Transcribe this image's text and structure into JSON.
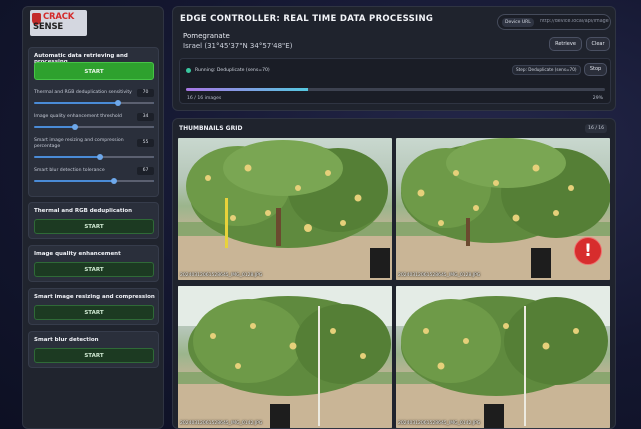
{
  "brand": {
    "line1": "CRACK",
    "line2": "SENSE"
  },
  "sidebar": {
    "auto_card": {
      "title": "Automatic data retrieving and processing",
      "start_label": "START",
      "sliders": [
        {
          "label": "Thermal and RGB deduplication sensitivity",
          "value": "70",
          "fraction": 0.7
        },
        {
          "label": "Image quality enhancement threshold",
          "value": "34",
          "fraction": 0.34
        },
        {
          "label": "Smart image resizing and compression percentage",
          "value": "55",
          "fraction": 0.55
        },
        {
          "label": "Smart blur detection tolerance",
          "value": "67",
          "fraction": 0.67
        }
      ]
    },
    "cards": [
      {
        "title": "Thermal and RGB deduplication",
        "start_label": "START"
      },
      {
        "title": "Image quality enhancement",
        "start_label": "START"
      },
      {
        "title": "Smart image resizing and compression",
        "start_label": "START"
      },
      {
        "title": "Smart blur detection",
        "start_label": "START"
      }
    ]
  },
  "header": {
    "title": "EDGE CONTROLLER: REAL TIME DATA PROCESSING",
    "crop": "Pomegranate",
    "location": "Israel (31°45'37\"N 34°57'48\"E)",
    "device_url_label": "Device URL",
    "device_url_placeholder": "http://device.local/api/image",
    "retrieve_label": "Retrieve",
    "clear_label": "Clear",
    "status_text": "Running: Deduplicate (sens=70)",
    "step_badge": "Step: Deduplicate (sens=70)",
    "stop_label": "Stop",
    "progress_left": "16 / 16 images",
    "progress_right": "29%",
    "progress_fraction": 0.29
  },
  "grid": {
    "title": "THUMBNAILS GRID",
    "count": "16 / 16",
    "thumbs": [
      {
        "caption": "20240312061528645_IMG_0128.JPG"
      },
      {
        "caption": "20240312061528645_IMG_0128.JPG",
        "alert": "!"
      },
      {
        "caption": "20240312061528645_IMG_0142.JPG"
      },
      {
        "caption": "20240312061528645_IMG_0142.JPG"
      }
    ]
  },
  "colors": {
    "accent_green": "#2ea12e",
    "slider_blue": "#4a8bd6",
    "alert_red": "#d72d2d",
    "status_dot": "#3ac8a0"
  }
}
